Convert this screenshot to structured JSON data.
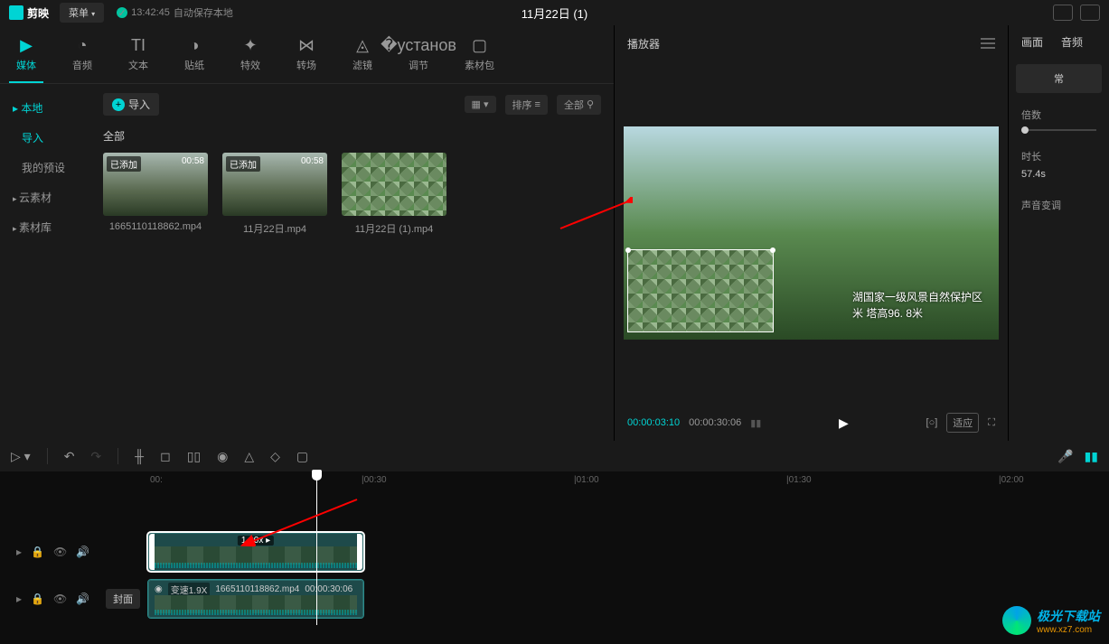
{
  "topbar": {
    "app_name": "剪映",
    "menu": "菜单",
    "autosave_time": "13:42:45",
    "autosave_text": "自动保存本地",
    "title": "11月22日 (1)"
  },
  "toolTabs": [
    {
      "label": "媒体",
      "icon": "▢"
    },
    {
      "label": "音频",
      "icon": "◔"
    },
    {
      "label": "文本",
      "icon": "TI"
    },
    {
      "label": "贴纸",
      "icon": "◑"
    },
    {
      "label": "特效",
      "icon": "✦"
    },
    {
      "label": "转场",
      "icon": "⋈"
    },
    {
      "label": "滤镜",
      "icon": "△"
    },
    {
      "label": "调节",
      "icon": "⚙"
    },
    {
      "label": "素材包",
      "icon": "▭"
    }
  ],
  "sidebar": {
    "items": [
      {
        "label": "本地",
        "active": true,
        "section": true
      },
      {
        "label": "导入",
        "active": true,
        "sub": true
      },
      {
        "label": "我的预设",
        "sub": true
      },
      {
        "label": "云素材",
        "section": true
      },
      {
        "label": "素材库",
        "section": true
      }
    ]
  },
  "mediaHeader": {
    "import": "导入",
    "sort": "排序",
    "all": "全部"
  },
  "gallery": {
    "label": "全部",
    "items": [
      {
        "badge": "已添加",
        "dur": "00:58",
        "name": "1665110118862.mp4"
      },
      {
        "badge": "已添加",
        "dur": "00:58",
        "name": "11月22日.mp4"
      },
      {
        "badge": "",
        "dur": "",
        "name": "11月22日 (1).mp4"
      }
    ]
  },
  "player": {
    "title": "播放器",
    "overlay_l1": "湖国家一级风景自然保护区",
    "overlay_l2": "米 塔高96. 8米",
    "time_current": "00:00:03:10",
    "time_total": "00:00:30:06",
    "fit": "适应"
  },
  "props": {
    "tab1": "画面",
    "tab2": "音频",
    "section": "常",
    "speed_label": "倍数",
    "duration_label": "时长",
    "duration_val": "57.4s",
    "pitch_label": "声音变调"
  },
  "timeline": {
    "rulerMarks": [
      "00:",
      "|00:30",
      "|01:00",
      "|01:30",
      "|02:00"
    ],
    "clip1_speed": "1.90x ▸",
    "clip2_speed": "变速1.9X",
    "clip2_name": "1665110118862.mp4",
    "clip2_dur": "00:00:30:06",
    "cover": "封面"
  },
  "watermark": {
    "main": "极光下载站",
    "sub": "www.xz7.com"
  }
}
